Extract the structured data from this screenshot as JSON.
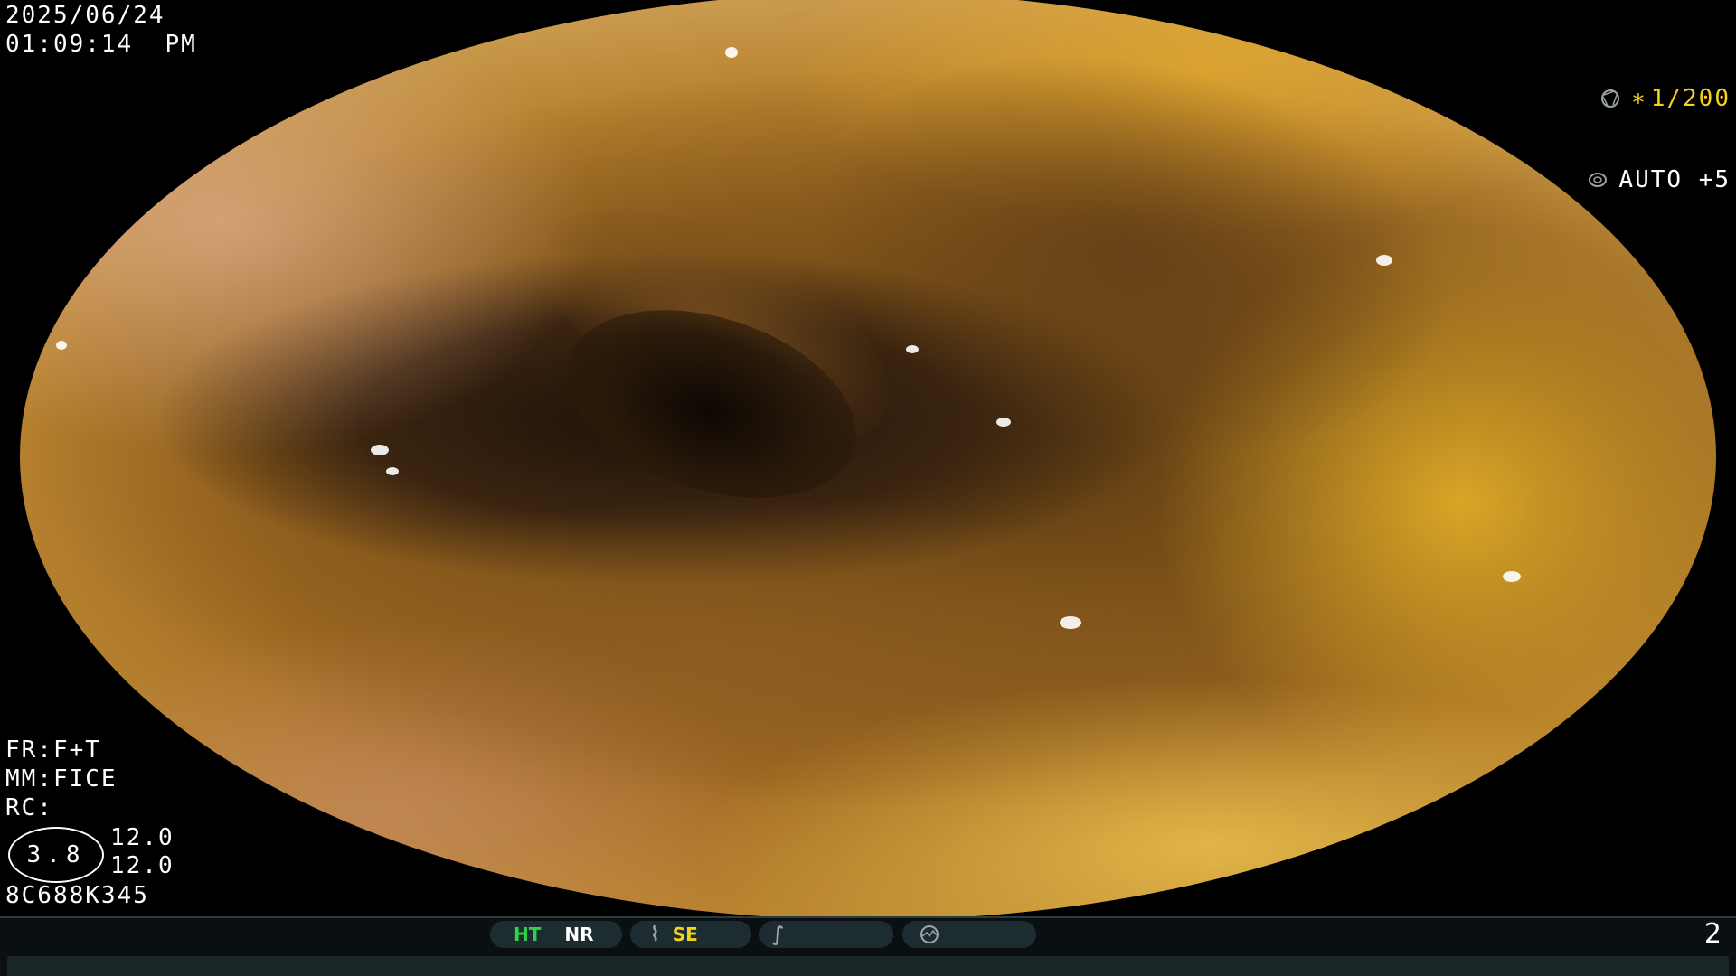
{
  "overlay": {
    "date": "2025/06/24",
    "time": "01:09:14  PM",
    "shutter_star": "∗",
    "shutter": "1/200",
    "auto_mode": "AUTO +5",
    "fr": "FR:F+T",
    "mm": "MM:FICE",
    "rc": "RC:",
    "gauge_main": "3.8",
    "gauge_val1": "12.0",
    "gauge_val2": "12.0",
    "serial": "8C688K345"
  },
  "status_bar": {
    "ht": "HT",
    "nr": "NR",
    "se": "SE",
    "page_number": "2"
  },
  "colors": {
    "accent_yellow": "#f5d21a",
    "ht_green": "#2fd24a",
    "bar_bg": "#0a1012",
    "pill_bg": "#1c2c30"
  },
  "icons": {
    "shutter": "aperture-icon",
    "auto": "iris-icon",
    "se": "signal-icon",
    "slash": "slash-icon",
    "dashboard": "dashboard-icon"
  }
}
